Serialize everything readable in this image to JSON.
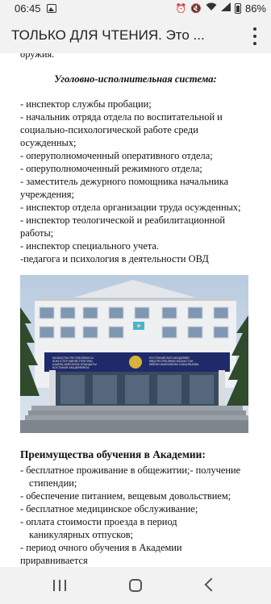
{
  "status_bar": {
    "time": "06:45",
    "icons": [
      "gallery-icon",
      "alarm-icon",
      "mute-icon",
      "wifi-icon",
      "signal-icon",
      "battery-icon"
    ],
    "battery": "86%"
  },
  "header": {
    "title": "ТОЛЬКО ДЛЯ ЧТЕНИЯ. Это ...",
    "menu_icon": "more-vertical-icon"
  },
  "document": {
    "cut_line": "оружия.",
    "section_title": "Уголовно-исполнительная система:",
    "duties": [
      "- инспектор службы пробации;",
      "- начальник отряда отдела по воспитательной и",
      "социально-психологической работе среди",
      "осужденных;",
      "- оперуполномоченный оперативного отдела;",
      "- оперуполномоченный режимного отдела;",
      "- заместитель дежурного помощника начальника",
      "учреждения;",
      "- инспектор отдела организации труда осужденных;",
      "- инспектор теологической и реабилитационной",
      "работы;",
      "- инспектор специального учета.",
      "-педагога и психология в деятельности ОВД"
    ],
    "photo": {
      "sign_left": [
        "ҚАЗАҚСТАН РЕСПУБЛИКАСЫ",
        "ІШКІ ІСТЕР МИНИСТРЛІГІНІҢ",
        "ШЫРАҚ БЕЙСЕНОВ АТЫНДАҒЫ",
        "ҚОСТАНАЙ АКАДЕМИЯСЫ"
      ],
      "sign_right": [
        "КОСТАНАЙСКАЯ АКАДЕМИЯ",
        "МВД РЕСПУБЛИКИ КАЗАХСТАН",
        "ИМЕНИ ШЫРАКБЕКА КАБЫЛБАЕВА"
      ]
    },
    "advantages_title": "Преимущества обучения в Академии:",
    "advantages": [
      {
        "text": "- бесплатное проживание в общежитии;- получение",
        "indent": false
      },
      {
        "text": "стипендии;",
        "indent": true
      },
      {
        "text": "- обеспечение питанием, вещевым довольствием;",
        "indent": false
      },
      {
        "text": "- бесплатное медицинское обслуживание;",
        "indent": false
      },
      {
        "text": "- оплата стоимости проезда в период",
        "indent": false
      },
      {
        "text": "каникулярных отпусков;",
        "indent": true
      },
      {
        "text": "- период очного обучения в Академии",
        "indent": false
      },
      {
        "text": "приравнивается",
        "indent": false
      }
    ]
  },
  "nav_bar": {
    "icons": [
      "recent-apps-icon",
      "home-icon",
      "back-icon"
    ]
  },
  "colors": {
    "bars": "#f2f2f2",
    "text": "#111111",
    "flag": "#3fb6d9"
  }
}
